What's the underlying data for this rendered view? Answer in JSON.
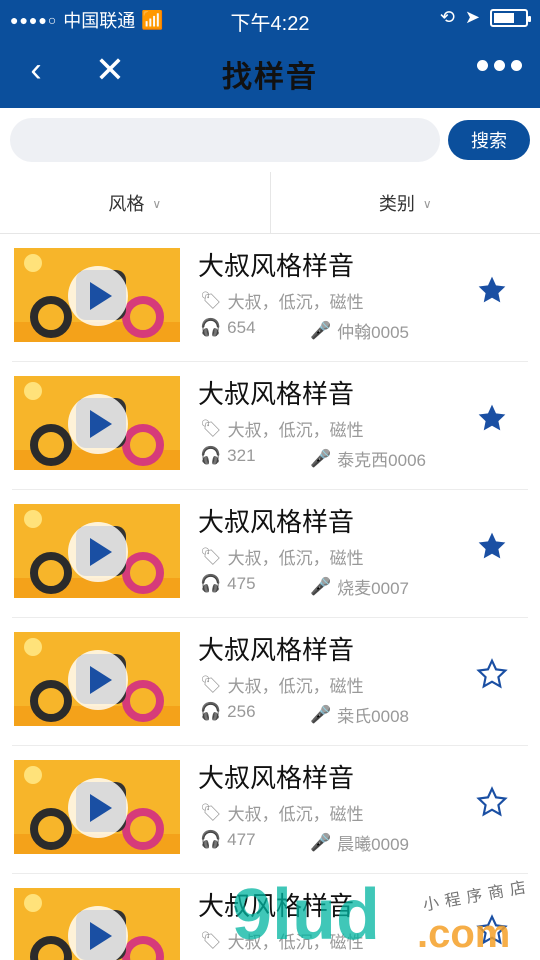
{
  "status": {
    "carrier": "中国联通",
    "time": "下午4:22"
  },
  "nav": {
    "title": "找样音"
  },
  "search": {
    "placeholder": "",
    "button_label": "搜索"
  },
  "filters": [
    {
      "label": "风格"
    },
    {
      "label": "类别"
    }
  ],
  "items": [
    {
      "title": "大叔风格样音",
      "tags": "大叔，低沉，磁性",
      "plays": "654",
      "author": "仲翰0005",
      "favorited": true
    },
    {
      "title": "大叔风格样音",
      "tags": "大叔，低沉，磁性",
      "plays": "321",
      "author": "泰克西0006",
      "favorited": true
    },
    {
      "title": "大叔风格样音",
      "tags": "大叔，低沉，磁性",
      "plays": "475",
      "author": "烧麦0007",
      "favorited": true
    },
    {
      "title": "大叔风格样音",
      "tags": "大叔，低沉，磁性",
      "plays": "256",
      "author": "桒氏0008",
      "favorited": false
    },
    {
      "title": "大叔风格样音",
      "tags": "大叔，低沉，磁性",
      "plays": "477",
      "author": "晨曦0009",
      "favorited": false
    },
    {
      "title": "大叔风格样音",
      "tags": "大叔，低沉，磁性",
      "plays": "",
      "author": "",
      "favorited": false
    }
  ],
  "colors": {
    "primary": "#0b4f9c",
    "star": "#1a4fa3"
  },
  "watermark": {
    "big": "9lud",
    "com": ".com",
    "small": "小程序商店"
  }
}
